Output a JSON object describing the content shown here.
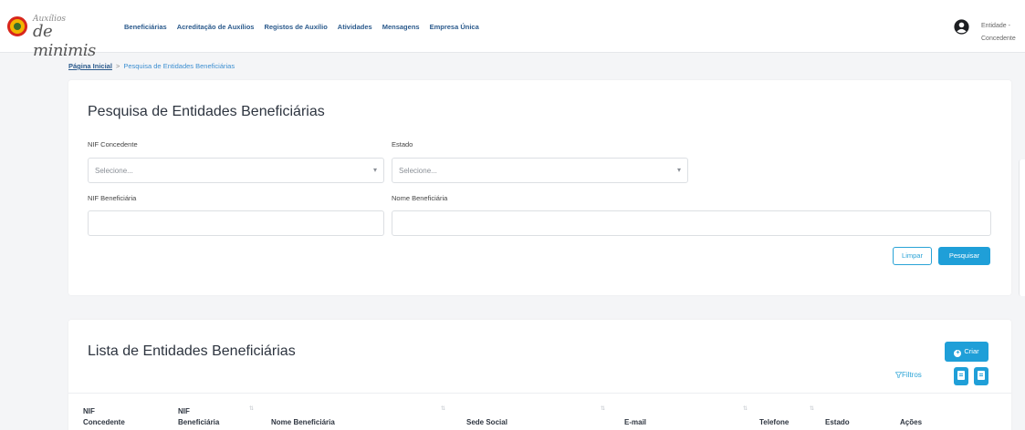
{
  "header": {
    "logo_sup": "Auxílios",
    "logo_main": "de minimis",
    "nav": [
      "Beneficiárias",
      "Acreditação de Auxílios",
      "Registos de Auxílio",
      "Atividades",
      "Mensagens",
      "Empresa Única"
    ],
    "user_line1": "Entidade -",
    "user_line2": "Concedente"
  },
  "breadcrumb": {
    "home": "Página Inicial",
    "separator": ">",
    "current": "Pesquisa de Entidades Beneficiárias"
  },
  "search": {
    "title": "Pesquisa de Entidades Beneficiárias",
    "nif_concedente_label": "NIF Concedente",
    "nif_concedente_placeholder": "Selecione...",
    "estado_label": "Estado",
    "estado_placeholder": "Selecione...",
    "nif_beneficiaria_label": "NIF Beneficiária",
    "nome_beneficiaria_label": "Nome Beneficiária",
    "limpar": "Limpar",
    "pesquisar": "Pesquisar"
  },
  "list": {
    "title": "Lista de Entidades Beneficiárias",
    "criar": "Criar",
    "filtros": "Filtros",
    "columns": [
      "NIF Concedente",
      "NIF Beneficiária",
      "Nome Beneficiária",
      "Sede Social",
      "E-mail",
      "Telefone",
      "Estado",
      "Ações"
    ]
  },
  "icons": {
    "dropdown": "chevron-down-icon",
    "user": "user-circle-icon",
    "filter": "filter-icon",
    "sort": "sort-icon",
    "plus": "plus-icon",
    "export": "document-icon"
  },
  "colors": {
    "accent": "#1f9fd8",
    "nav_link": "#2b5a8c",
    "page_bg": "#f4f5f7"
  }
}
